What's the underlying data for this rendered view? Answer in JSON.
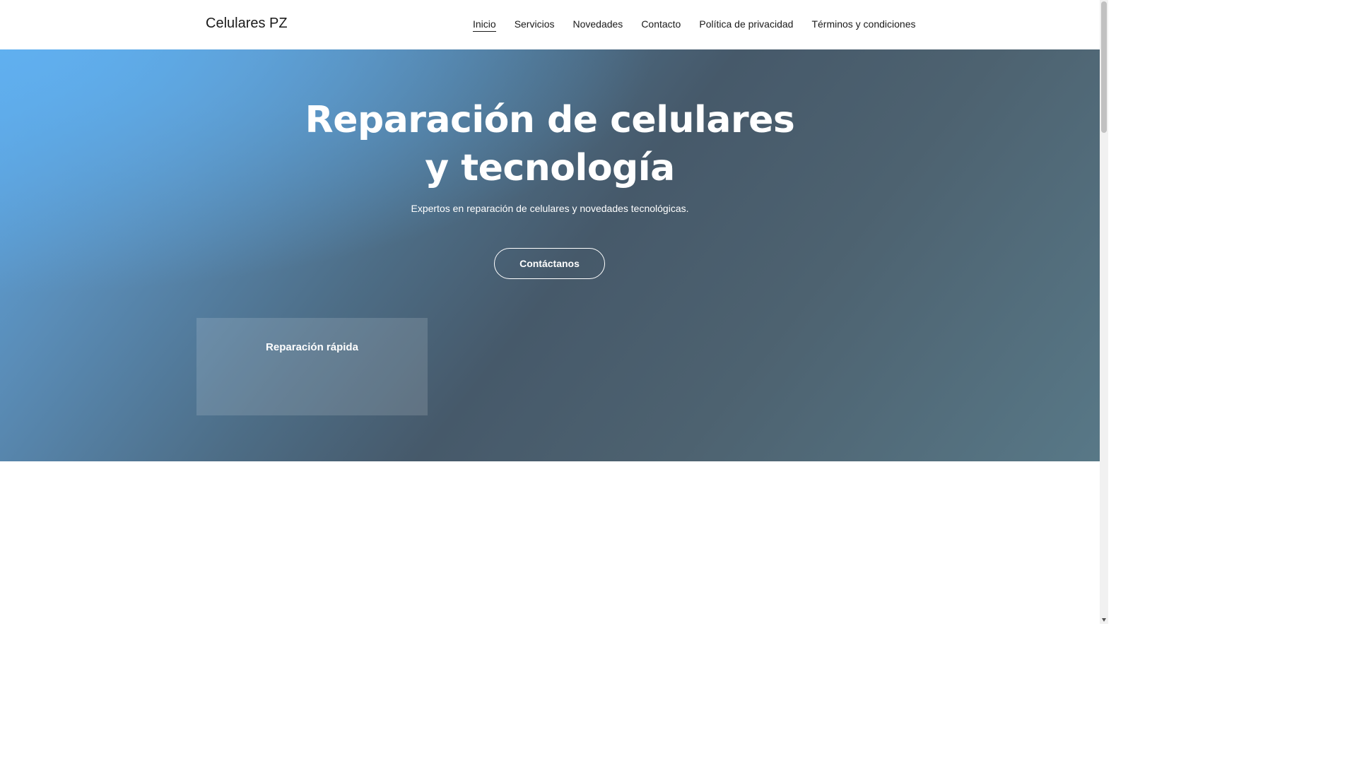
{
  "header": {
    "brand": "Celulares PZ",
    "nav": [
      {
        "label": "Inicio",
        "active": true
      },
      {
        "label": "Servicios",
        "active": false
      },
      {
        "label": "Novedades",
        "active": false
      },
      {
        "label": "Contacto",
        "active": false
      },
      {
        "label": "Política de privacidad",
        "active": false
      },
      {
        "label": "Términos y condiciones",
        "active": false
      }
    ]
  },
  "hero": {
    "title_line1": "Reparación de celulares",
    "title_line2": "y tecnología",
    "subtitle": "Expertos en reparación de celulares y novedades tecnológicas.",
    "cta_label": "Contáctanos",
    "feature_card_title": "Reparación rápida"
  },
  "colors": {
    "hero_gradient_start": "#5ea8e6",
    "hero_gradient_mid": "#46596a",
    "hero_gradient_end": "#587887",
    "text_dark": "#1a1a1a",
    "text_light": "#ffffff"
  },
  "icons": {
    "scrollbar_down": "chevron-down-icon"
  }
}
